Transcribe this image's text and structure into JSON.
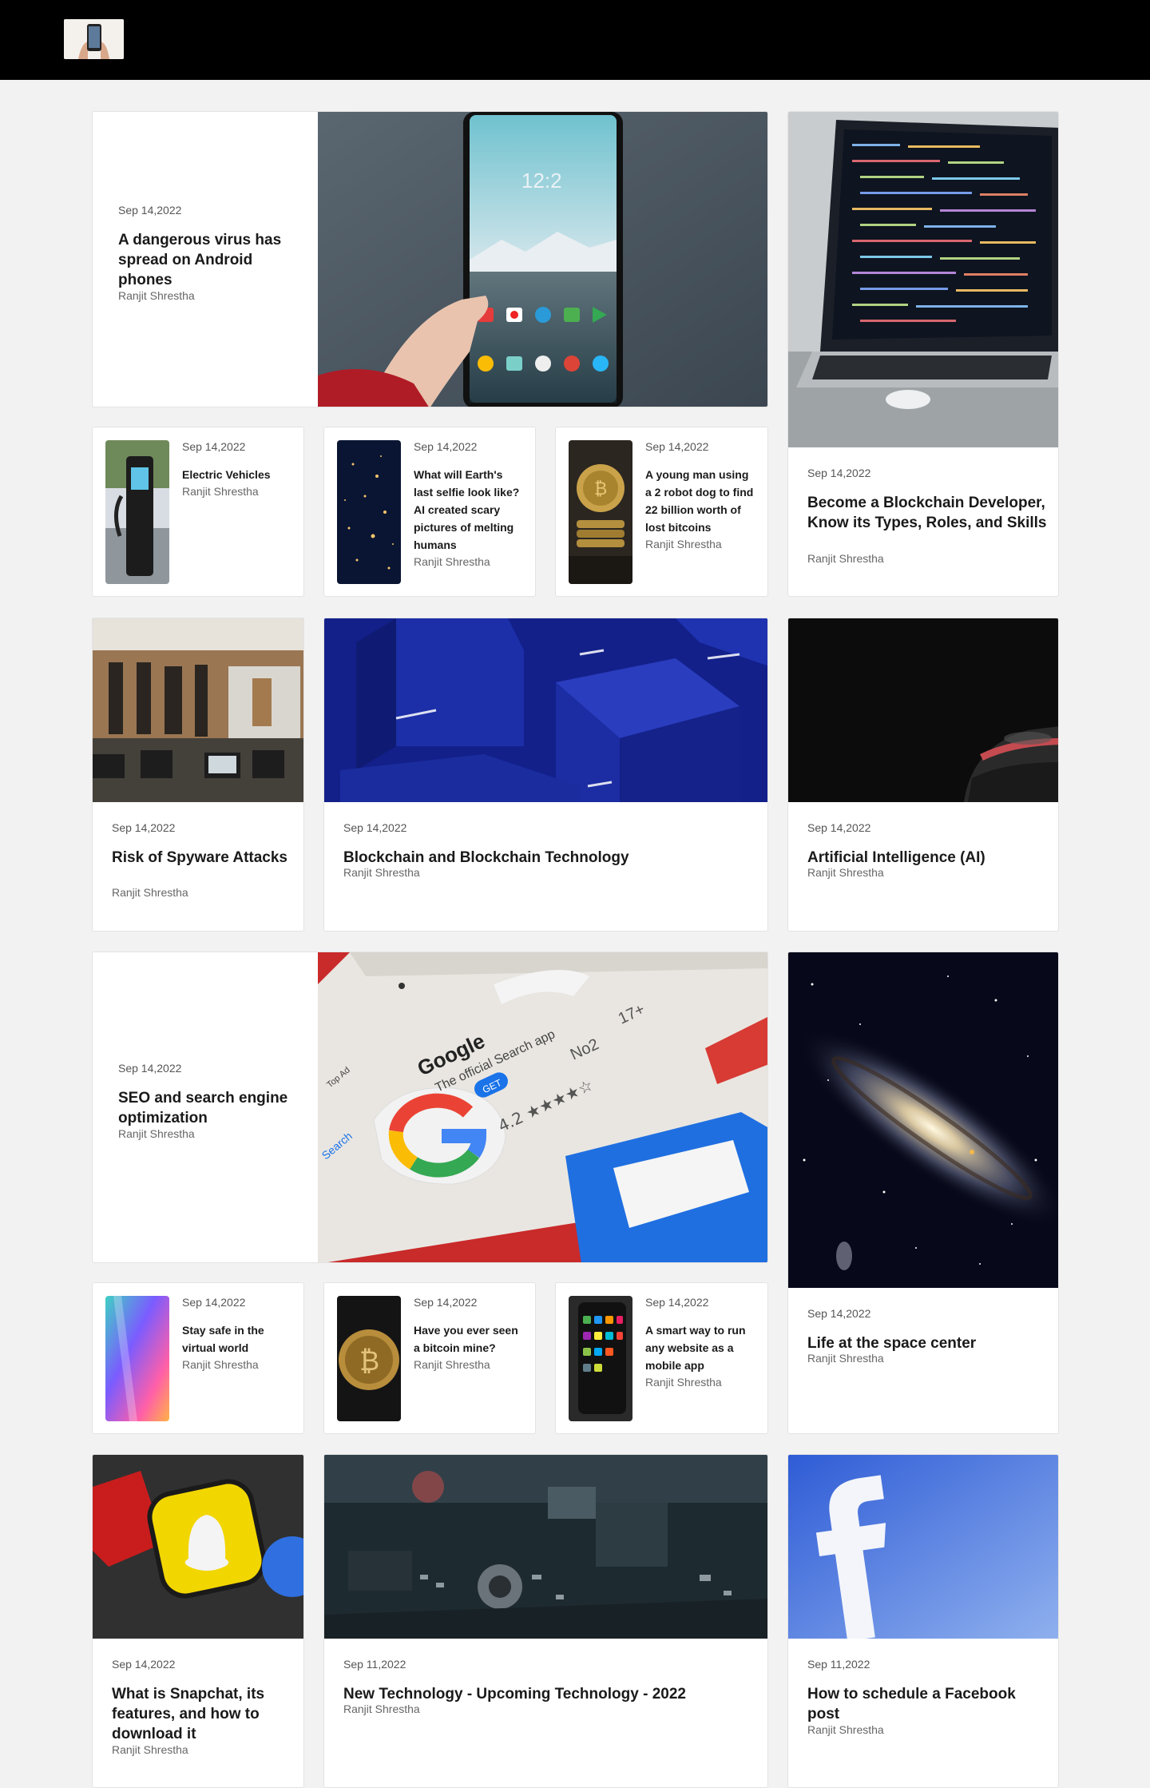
{
  "header": {
    "logo_icon": "phone-hand-logo-icon"
  },
  "colors": {
    "header_bg": "#000000",
    "page_bg": "#f2f2f2",
    "card_bg": "#ffffff"
  },
  "posts": {
    "android": {
      "date": "Sep 14,2022",
      "title": "A dangerous virus has spread on Android phones",
      "author": "Ranjit Shrestha"
    },
    "blockchain_dev": {
      "date": "Sep 14,2022",
      "title": "Become a Blockchain Developer, Know its Types, Roles, and Skills",
      "author": "Ranjit Shrestha"
    },
    "ev": {
      "date": "Sep 14,2022",
      "title": "Electric Vehicles",
      "author": "Ranjit Shrestha"
    },
    "selfie": {
      "date": "Sep 14,2022",
      "title": "What will Earth's last selfie look like? AI created scary pictures of melting humans",
      "author": "Ranjit Shrestha"
    },
    "robot_dog": {
      "date": "Sep 14,2022",
      "title": "A young man using a 2 robot dog to find 22 billion worth of lost bitcoins",
      "author": "Ranjit Shrestha"
    },
    "spyware": {
      "date": "Sep 14,2022",
      "title": "Risk of Spyware Attacks",
      "author": "Ranjit Shrestha"
    },
    "blockchain_tech": {
      "date": "Sep 14,2022",
      "title": "Blockchain and Blockchain Technology",
      "author": "Ranjit Shrestha"
    },
    "ai": {
      "date": "Sep 14,2022",
      "title": "Artificial Intelligence (AI)",
      "author": "Ranjit Shrestha"
    },
    "seo": {
      "date": "Sep 14,2022",
      "title": "SEO and search engine optimization",
      "author": "Ranjit Shrestha"
    },
    "space": {
      "date": "Sep 14,2022",
      "title": "Life at the space center",
      "author": "Ranjit Shrestha"
    },
    "virtual": {
      "date": "Sep 14,2022",
      "title": "Stay safe in the virtual world",
      "author": "Ranjit Shrestha"
    },
    "bitcoin_mine": {
      "date": "Sep 14,2022",
      "title": "Have you ever seen a bitcoin mine?",
      "author": "Ranjit Shrestha"
    },
    "mobile_app": {
      "date": "Sep 14,2022",
      "title": "A smart way to run any website as a mobile app",
      "author": "Ranjit Shrestha"
    },
    "snapchat": {
      "date": "Sep 14,2022",
      "title": "What is Snapchat, its features, and how to download it",
      "author": "Ranjit Shrestha"
    },
    "new_tech": {
      "date": "Sep 11,2022",
      "title": "New Technology - Upcoming Technology - 2022",
      "author": "Ranjit Shrestha"
    },
    "facebook": {
      "date": "Sep 11,2022",
      "title": "How to schedule a Facebook post",
      "author": "Ranjit Shrestha"
    }
  },
  "seo_image": {
    "brand": "Google",
    "subtitle": "The official Search app",
    "button": "GET",
    "rating": "4.2 ★★★★☆",
    "rank": "No2",
    "age": "17+",
    "search": "Search",
    "tab": "Top Ad"
  },
  "android_image": {
    "clock": "12:2"
  }
}
